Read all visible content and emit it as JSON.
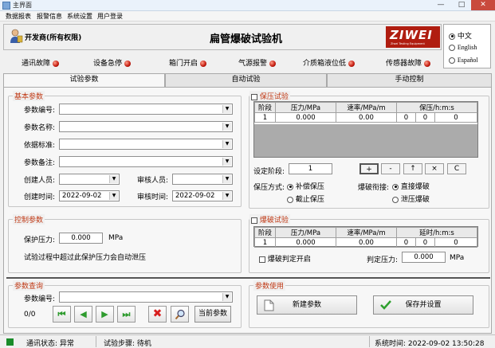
{
  "window": {
    "title": "主界面",
    "controls": [
      "—",
      "□",
      "✕"
    ]
  },
  "menu": [
    "数据报表",
    "报警信息",
    "系统设置",
    "用户登录"
  ],
  "user": {
    "label": "开发商(所有权限)"
  },
  "app_title": "扁管爆破试验机",
  "logo": {
    "text": "ZIWEI",
    "subtext": "Ziwei Testing Equipment"
  },
  "languages": [
    {
      "label": "中文",
      "selected": true
    },
    {
      "label": "English",
      "selected": false
    },
    {
      "label": "Español",
      "selected": false
    }
  ],
  "indicators": [
    {
      "label": "通讯故障"
    },
    {
      "label": "设备急停"
    },
    {
      "label": "箱门开启"
    },
    {
      "label": "气源报警"
    },
    {
      "label": "介质箱液位低"
    },
    {
      "label": "传感器故障"
    }
  ],
  "tabs": [
    {
      "label": "试验参数",
      "active": true
    },
    {
      "label": "自动试验",
      "active": false
    },
    {
      "label": "手动控制",
      "active": false
    }
  ],
  "basic": {
    "title": "基本参数",
    "param_no": "参数编号:",
    "param_name": "参数名称:",
    "standard": "依据标准:",
    "note": "参数备注:",
    "creator": "创建人员:",
    "reviewer": "审核人员:",
    "create_time": "创建时间:",
    "create_date": "2022-09-02",
    "review_time": "审核时间:",
    "review_date": "2022-09-02"
  },
  "control": {
    "title": "控制参数",
    "protect_label": "保护压力:",
    "protect_value": "0.000",
    "unit": "MPa",
    "note": "试验过程中超过此保护压力会自动泄压"
  },
  "hold": {
    "title": "保压试验",
    "columns": [
      "阶段",
      "压力/MPa",
      "速率/MPa/m",
      "保压/h:m:s"
    ],
    "rows": [
      {
        "stage": "1",
        "pressure": "0.000",
        "rate": "0.00",
        "h": "0",
        "m": "0",
        "s": "0"
      }
    ],
    "set_stage_label": "设定阶段:",
    "set_stage_value": "1",
    "buttons": [
      "+",
      "-",
      "↑",
      "×",
      "C"
    ],
    "mode_label": "保压方式:",
    "mode_options": [
      {
        "label": "补偿保压",
        "selected": true
      },
      {
        "label": "截止保压",
        "selected": false
      }
    ],
    "burst_label": "爆破衔接:",
    "burst_options": [
      {
        "label": "直接爆破",
        "selected": true
      },
      {
        "label": "泄压爆破",
        "selected": false
      }
    ]
  },
  "burst": {
    "title": "爆破试验",
    "columns": [
      "阶段",
      "压力/MPa",
      "速率/MPa/m",
      "延时/h:m:s"
    ],
    "rows": [
      {
        "stage": "1",
        "pressure": "0.000",
        "rate": "0.00",
        "h": "0",
        "m": "0",
        "s": "0"
      }
    ],
    "judge_enable": "爆破判定开启",
    "judge_pressure_label": "判定压力:",
    "judge_pressure_value": "0.000",
    "unit": "MPa"
  },
  "query": {
    "title": "参数查询",
    "param_no": "参数编号:",
    "count": "0/0",
    "current_param": "当前参数"
  },
  "use": {
    "title": "参数使用",
    "new_param": "新建参数",
    "save_apply": "保存并设置"
  },
  "status": {
    "comm": "通讯状态: 异常",
    "step": "试验步骤: 待机",
    "time": "系统时间: 2022-09-02 13:50:28"
  },
  "colors": {
    "accent": "#c03a16",
    "led": "#c2180c",
    "logo_bg": "#b01d10",
    "indicator": "#1a8c2a"
  }
}
